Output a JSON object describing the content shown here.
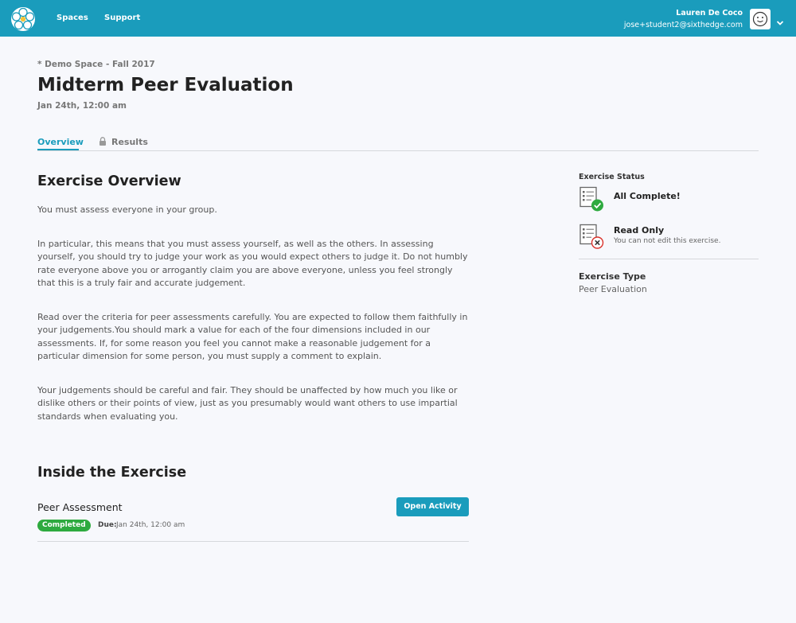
{
  "nav": {
    "spaces": "Spaces",
    "support": "Support"
  },
  "user": {
    "name": "Lauren De Coco",
    "email": "jose+student2@sixthedge.com"
  },
  "page": {
    "breadcrumb": "* Demo Space - Fall 2017",
    "title": "Midterm Peer Evaluation",
    "date": "Jan 24th, 12:00 am"
  },
  "tabs": {
    "overview": "Overview",
    "results": "Results"
  },
  "overview": {
    "heading": "Exercise Overview",
    "paragraphs": [
      "You must assess everyone in your group.",
      "In particular, this means that you must assess yourself, as well as the others. In assessing yourself, you should try to judge your work as you would expect others to judge it. Do not humbly rate everyone above you or arrogantly claim you are above everyone, unless you feel strongly that this is a truly fair and accurate judgement.",
      "Read over the criteria for peer assessments carefully. You are expected to follow them faithfully in your judgements.You should mark a value for each of the four dimensions included in our assessments. If, for some reason you feel you cannot make a reasonable judgement for a particular dimension for some person, you must supply a comment to explain.",
      "Your judgements should be careful and fair. They should be unaffected by how much you like or dislike others or their points of view, just as you presumably would want others to use impartial standards when evaluating you."
    ]
  },
  "inside": {
    "heading": "Inside the Exercise",
    "task_name": "Peer Assessment",
    "open_button": "Open Activity",
    "status_badge": "Completed",
    "due_label": "Due:",
    "due_value": "Jan 24th, 12:00 am"
  },
  "sidebar": {
    "status_heading": "Exercise Status",
    "complete_label": "All Complete!",
    "read_only_label": "Read Only",
    "read_only_sub": "You can not edit this exercise.",
    "type_label": "Exercise Type",
    "type_value": "Peer Evaluation"
  },
  "colors": {
    "brand": "#1a9cbc",
    "success": "#2eaa3f",
    "danger": "#d9322b"
  }
}
